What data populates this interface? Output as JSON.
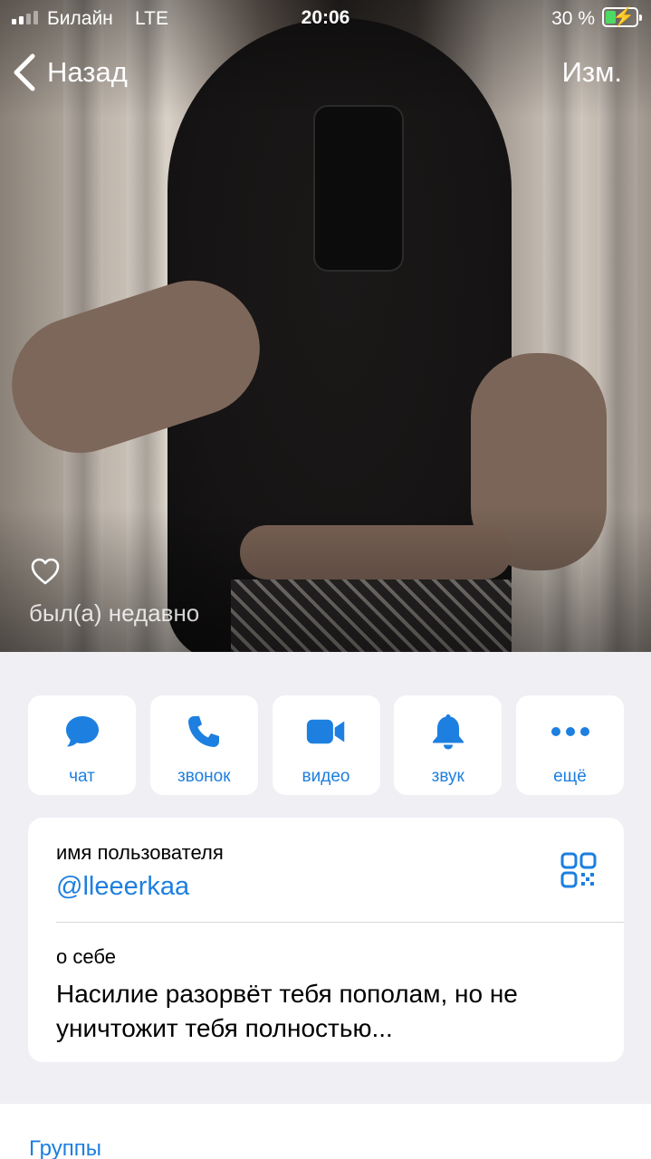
{
  "status_bar": {
    "carrier": "Билайн",
    "network": "LTE",
    "time": "20:06",
    "battery_percent": "30 %",
    "battery_level": 0.3,
    "battery_charging": true
  },
  "nav": {
    "back_label": "Назад",
    "edit_label": "Изм."
  },
  "profile": {
    "last_seen": "был(а) недавно"
  },
  "actions": [
    {
      "label": "чат",
      "icon": "chat-bubble-icon"
    },
    {
      "label": "звонок",
      "icon": "phone-icon"
    },
    {
      "label": "видео",
      "icon": "video-camera-icon"
    },
    {
      "label": "звук",
      "icon": "bell-icon"
    },
    {
      "label": "ещё",
      "icon": "more-dots-icon"
    }
  ],
  "info": {
    "username_title": "имя пользователя",
    "username": "@lleeerkaa",
    "bio_title": "о себе",
    "bio": "Насилие разорвёт тебя пополам, но не уничтожит тебя полностью..."
  },
  "sections": {
    "groups_label": "Группы"
  },
  "colors": {
    "accent": "#1d7fe0",
    "background": "#efeff4",
    "battery_fill": "#4cd964"
  }
}
